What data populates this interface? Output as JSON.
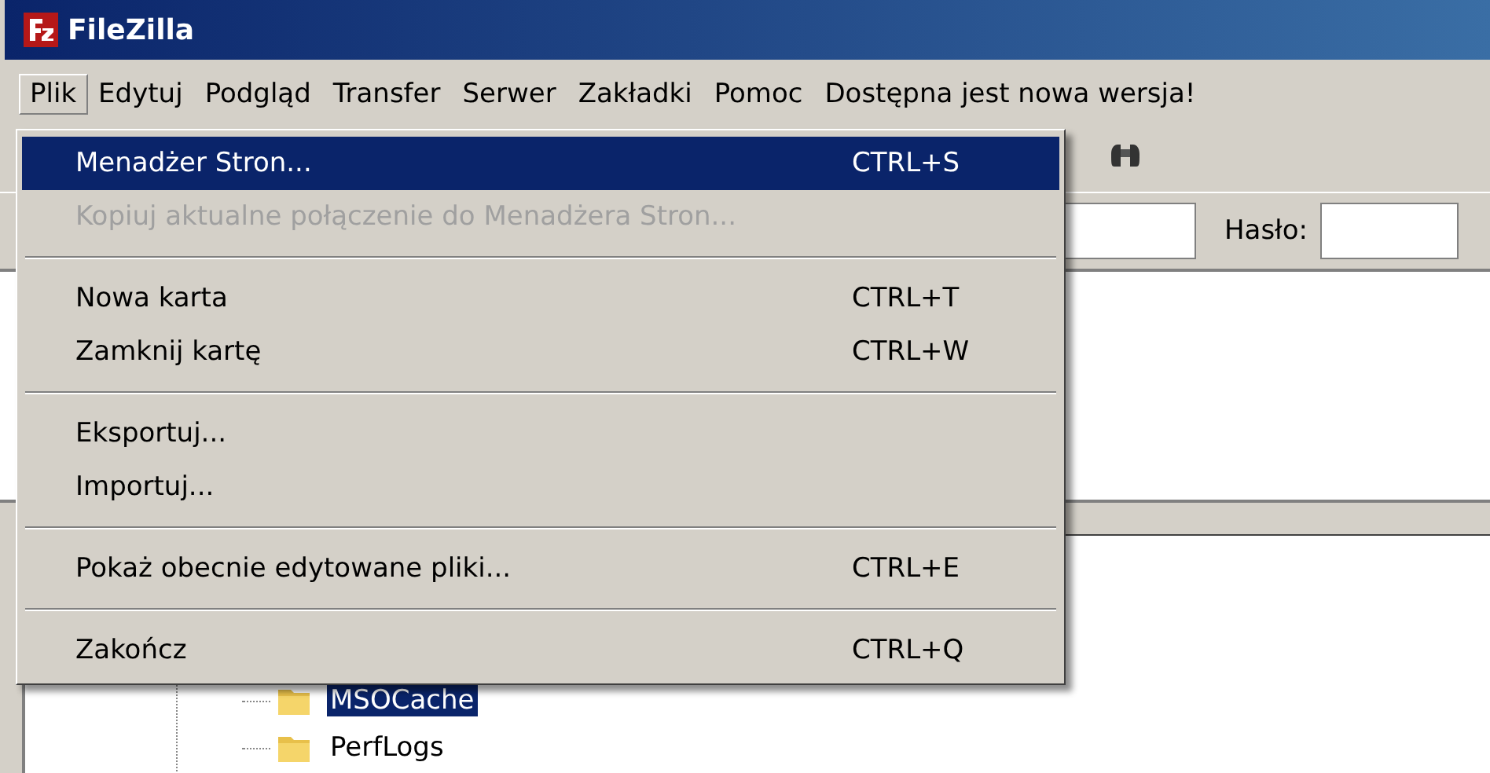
{
  "window": {
    "title": "FileZilla"
  },
  "menubar": [
    {
      "label": "Plik",
      "selected": true
    },
    {
      "label": "Edytuj",
      "selected": false
    },
    {
      "label": "Podgląd",
      "selected": false
    },
    {
      "label": "Transfer",
      "selected": false
    },
    {
      "label": "Serwer",
      "selected": false
    },
    {
      "label": "Zakładki",
      "selected": false
    },
    {
      "label": "Pomoc",
      "selected": false
    },
    {
      "label": "Dostępna jest nowa wersja!",
      "selected": false
    }
  ],
  "menu": [
    {
      "kind": "item",
      "label": "Menadżer Stron...",
      "shortcut": "CTRL+S",
      "selected": true,
      "disabled": false
    },
    {
      "kind": "item",
      "label": "Kopiuj aktualne połączenie do Menadżera Stron...",
      "selected": false,
      "disabled": true
    },
    {
      "kind": "separator"
    },
    {
      "kind": "item",
      "label": "Nowa karta",
      "shortcut": "CTRL+T",
      "selected": false,
      "disabled": false
    },
    {
      "kind": "item",
      "label": "Zamknij kartę",
      "shortcut": "CTRL+W",
      "selected": false,
      "disabled": false
    },
    {
      "kind": "separator"
    },
    {
      "kind": "item",
      "label": "Eksportuj...",
      "selected": false,
      "disabled": false
    },
    {
      "kind": "item",
      "label": "Importuj...",
      "selected": false,
      "disabled": false
    },
    {
      "kind": "separator"
    },
    {
      "kind": "item",
      "label": "Pokaż obecnie edytowane pliki...",
      "shortcut": "CTRL+E",
      "selected": false,
      "disabled": false
    },
    {
      "kind": "separator"
    },
    {
      "kind": "item",
      "label": "Zakończ",
      "shortcut": "CTRL+Q",
      "selected": false,
      "disabled": false
    }
  ],
  "quickconnect": {
    "password_label": "Hasło:"
  },
  "tree": [
    {
      "label": "MSOCache",
      "selected": true
    },
    {
      "label": "PerfLogs",
      "selected": false
    }
  ]
}
